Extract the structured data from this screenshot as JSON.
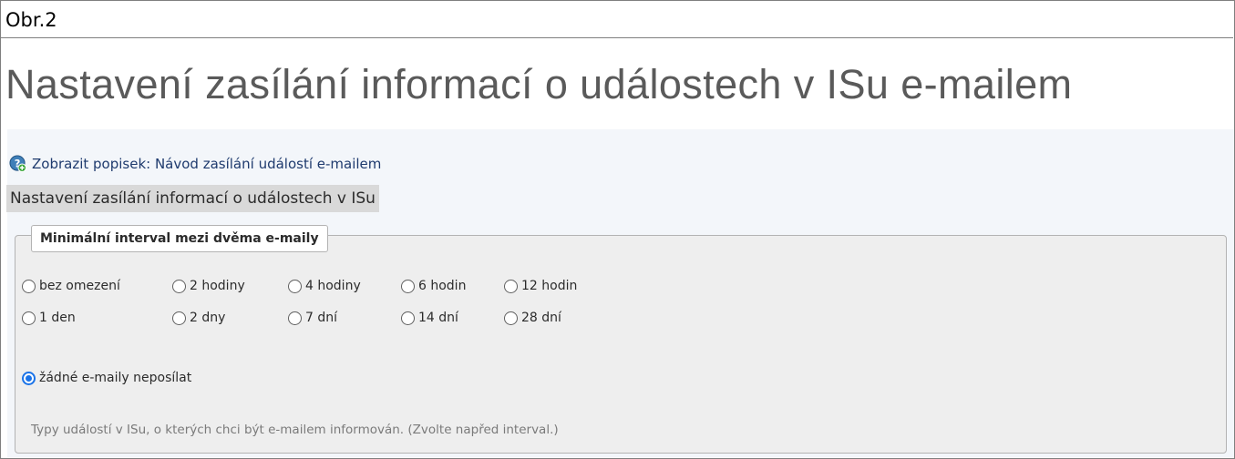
{
  "caption": "Obr.2",
  "page_title": "Nastavení zasílání informací o událostech v ISu e-mailem",
  "help_link": {
    "icon": "help-plus-icon",
    "label": "Zobrazit popisek: Návod zasílání událostí e-mailem"
  },
  "section_title": "Nastavení zasílání informací o událostech v ISu",
  "interval": {
    "legend": "Minimální interval mezi dvěma e-maily",
    "options": [
      {
        "label": "bez omezení",
        "checked": false
      },
      {
        "label": "2 hodiny",
        "checked": false
      },
      {
        "label": "4 hodiny",
        "checked": false
      },
      {
        "label": "6 hodin",
        "checked": false
      },
      {
        "label": "12 hodin",
        "checked": false
      },
      {
        "label": "1 den",
        "checked": false
      },
      {
        "label": "2 dny",
        "checked": false
      },
      {
        "label": "7 dní",
        "checked": false
      },
      {
        "label": "14 dní",
        "checked": false
      },
      {
        "label": "28 dní",
        "checked": false
      }
    ],
    "none_option": {
      "label": "žádné e-maily neposílat",
      "checked": true
    }
  },
  "types_note": "Typy událostí v ISu, o kterých chci být e-mailem informován. (Zvolte napřed interval.)",
  "colors": {
    "accent": "#1a73e8",
    "link": "#1f3b6e",
    "heading": "#5a5a5a"
  }
}
